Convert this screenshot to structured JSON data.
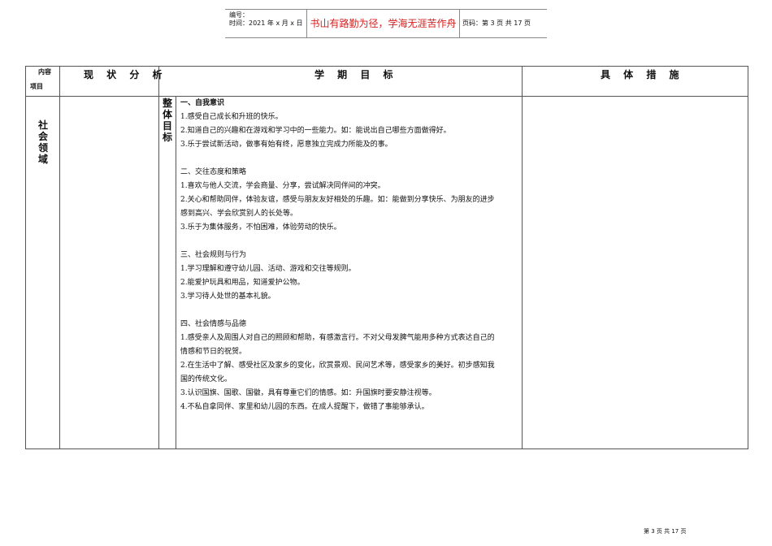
{
  "header": {
    "number_label": "编号：",
    "time_label": "时间：2021 年 x 月 x 日",
    "motto": "书山有路勤为径，学海无涯苦作舟",
    "page_info": "页码：第 3 页  共 17 页"
  },
  "table": {
    "corner_top": "内容",
    "corner_bottom": "项目",
    "col_status": "现 状 分 析",
    "col_goals": "学 期 目 标",
    "col_measures": "具 体 措 施",
    "row_label": "社会领域",
    "sub_label": "整体目标",
    "lines": [
      "一、自我意识",
      "1.感受自己成长和升班的快乐。",
      "2.知道自己的兴趣和在游戏和学习中的一些能力。如：能说出自己哪些方面做得好。",
      "3.乐于尝试新活动，做事有始有终，愿意独立完成力所能及的事。",
      "",
      "二、交往态度和策略",
      "1.喜欢与他人交流，学会商量、分享，尝试解决同伴间的冲突。",
      "2.关心和帮助同伴，体验友谊，感受与朋友友好相处的乐趣。如：能做到分享快乐、为朋友的进步",
      "感到高兴、学会欣赏别人的长处等。",
      "3.乐于为集体服务，不怕困难，体验劳动的快乐。",
      "",
      "三、社会规则与行为",
      "1.学习理解和遵守幼儿园、活动、游戏和交往等规则。",
      "2.能爱护玩具和用品，知道爱护公物。",
      "3.学习待人处世的基本礼貌。",
      "",
      "四、社会情感与品德",
      "1.感受亲人及周围人对自己的照顾和帮助，有感激言行。不对父母发脾气能用多种方式表达自己的",
      "情感和节日的祝贺。",
      "2.在生活中了解、感受社区及家乡的变化，欣赏景观、民间艺术等，感受家乡的美好。初步感知我",
      "国的传统文化。",
      "3.认识国旗、国歌、国徽，具有尊重它们的情感。如：升国旗时要安静注视等。",
      "4.不私自拿同伴、家里和幼儿园的东西。在成人提醒下，做错了事能够承认。"
    ]
  },
  "footer": "第 3 页 共 17 页"
}
